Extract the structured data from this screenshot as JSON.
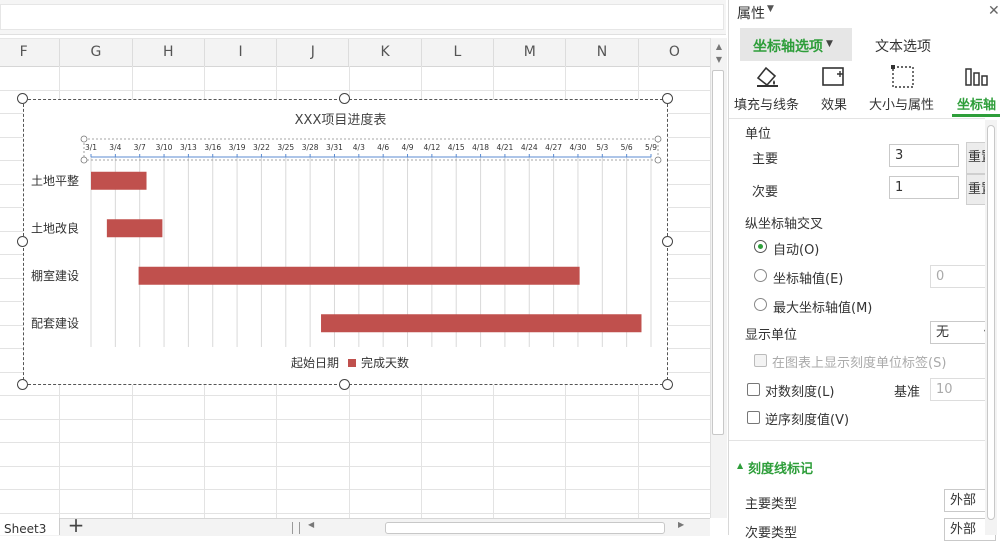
{
  "spreadsheet": {
    "columns": [
      "F",
      "G",
      "H",
      "I",
      "J",
      "K",
      "L",
      "M",
      "N",
      "O"
    ],
    "sheet_tab": "Sheet3",
    "add_sheet": "+"
  },
  "chart_data": {
    "type": "bar",
    "orientation": "horizontal-stacked-gantt",
    "title": "XXX项目进度表",
    "categories": [
      "土地平整",
      "土地改良",
      "棚室建设",
      "配套建设"
    ],
    "x_tick_labels": [
      "3/1",
      "3/4",
      "3/7",
      "3/10",
      "3/13",
      "3/16",
      "3/19",
      "3/22",
      "3/25",
      "3/28",
      "3/31",
      "4/3",
      "4/6",
      "4/9",
      "4/12",
      "4/15",
      "4/18",
      "4/21",
      "4/24",
      "4/27",
      "4/30",
      "5/3",
      "5/6",
      "5/9"
    ],
    "x_axis_position": "top",
    "grid": true,
    "series": [
      {
        "name": "起始日期",
        "values": [
          0,
          1,
          3,
          14.5
        ],
        "color": "none"
      },
      {
        "name": "完成天数",
        "values": [
          3.5,
          3.5,
          27.8,
          20.2
        ],
        "color": "#c0504d"
      }
    ],
    "xlim_days": [
      0,
      35.3
    ],
    "legend_position": "bottom",
    "legend": [
      "起始日期",
      "完成天数"
    ]
  },
  "panel": {
    "title": "属性",
    "tabs": [
      "坐标轴选项",
      "文本选项"
    ],
    "subtabs": [
      "填充与线条",
      "效果",
      "大小与属性",
      "坐标轴"
    ],
    "unit_label": "单位",
    "major_label": "主要",
    "major_value": "3",
    "minor_label": "次要",
    "minor_value": "1",
    "reset_label": "重置",
    "cross_label": "纵坐标轴交叉",
    "radio_auto": "自动(O)",
    "radio_value": "坐标轴值(E)",
    "radio_value_input": "0",
    "radio_max": "最大坐标轴值(M)",
    "display_unit_label": "显示单位",
    "display_unit_value": "无",
    "show_unit_label": "在图表上显示刻度单位标签(S)",
    "log_scale": "对数刻度(L)",
    "base_label": "基准",
    "base_value": "10",
    "reverse": "逆序刻度值(V)",
    "tick_section": "刻度线标记",
    "major_type_label": "主要类型",
    "major_type_value": "外部",
    "minor_type_label": "次要类型",
    "minor_type_value": "外部"
  },
  "colors": {
    "accent_green": "#2e9e3a",
    "bar_red": "#c0504d"
  }
}
